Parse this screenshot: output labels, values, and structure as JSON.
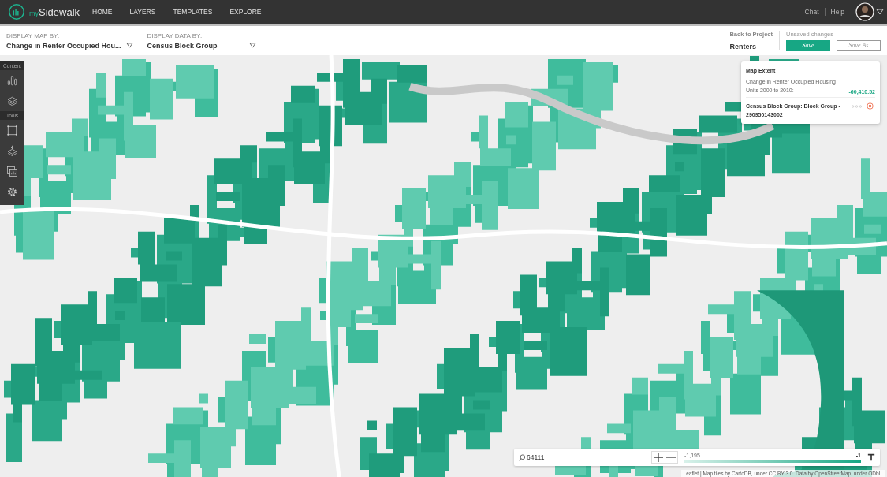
{
  "nav": {
    "brand_prefix": "my",
    "brand": "Sidewalk",
    "items": [
      {
        "label": "HOME"
      },
      {
        "label": "LAYERS"
      },
      {
        "label": "TEMPLATES"
      },
      {
        "label": "EXPLORE"
      }
    ],
    "links": [
      "Chat",
      "Help"
    ]
  },
  "toolbar": {
    "selectors": [
      {
        "label": "DISPLAY MAP BY:",
        "value": "Change in Renter Occupied Hou..."
      },
      {
        "label": "DISPLAY DATA BY:",
        "value": "Census Block Group"
      }
    ],
    "back_label": "Back to Project",
    "project": "Renters",
    "status": "Unsaved changes",
    "buttons": [
      {
        "label": "Save",
        "kind": "primary"
      },
      {
        "label": "Save As",
        "kind": "secondary"
      }
    ]
  },
  "sidebar": {
    "sections": [
      {
        "title": "Content",
        "tools": [
          {
            "kind": "chart"
          },
          {
            "kind": "layers"
          }
        ]
      },
      {
        "title": "Tools",
        "tools": [
          {
            "kind": "select"
          },
          {
            "kind": "addlayer"
          },
          {
            "kind": "report"
          },
          {
            "kind": "settings"
          }
        ]
      }
    ]
  },
  "popup": {
    "title": "Map Extent",
    "metric": "Change in Renter Occupied Housing Units 2000 to 2010:",
    "value": "-60,410.52",
    "selection": "Census Block Group: Block Group - 290950143002"
  },
  "bottom_bar": {
    "search": "64111",
    "legend_min": "-1,195",
    "legend_max": "-1"
  },
  "attribution": "Leaflet | Map tiles by CartoDB, under CC BY 3.0. Data by OpenStreetMap, under ODbL."
}
